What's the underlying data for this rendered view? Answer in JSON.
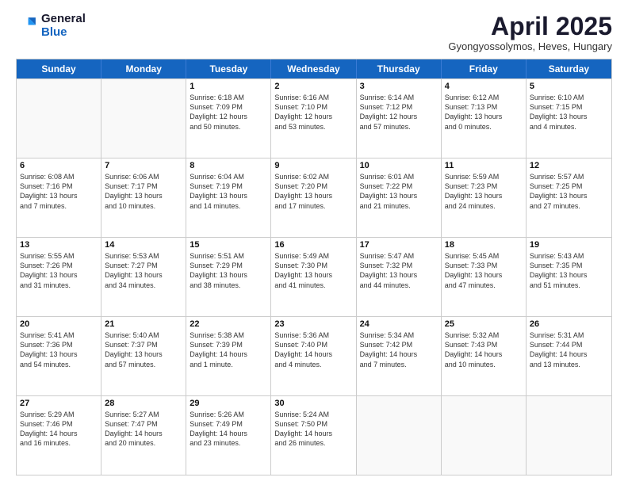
{
  "logo": {
    "general": "General",
    "blue": "Blue"
  },
  "title": "April 2025",
  "subtitle": "Gyongyossolymos, Heves, Hungary",
  "header_days": [
    "Sunday",
    "Monday",
    "Tuesday",
    "Wednesday",
    "Thursday",
    "Friday",
    "Saturday"
  ],
  "weeks": [
    [
      {
        "day": "",
        "info": ""
      },
      {
        "day": "",
        "info": ""
      },
      {
        "day": "1",
        "info": "Sunrise: 6:18 AM\nSunset: 7:09 PM\nDaylight: 12 hours\nand 50 minutes."
      },
      {
        "day": "2",
        "info": "Sunrise: 6:16 AM\nSunset: 7:10 PM\nDaylight: 12 hours\nand 53 minutes."
      },
      {
        "day": "3",
        "info": "Sunrise: 6:14 AM\nSunset: 7:12 PM\nDaylight: 12 hours\nand 57 minutes."
      },
      {
        "day": "4",
        "info": "Sunrise: 6:12 AM\nSunset: 7:13 PM\nDaylight: 13 hours\nand 0 minutes."
      },
      {
        "day": "5",
        "info": "Sunrise: 6:10 AM\nSunset: 7:15 PM\nDaylight: 13 hours\nand 4 minutes."
      }
    ],
    [
      {
        "day": "6",
        "info": "Sunrise: 6:08 AM\nSunset: 7:16 PM\nDaylight: 13 hours\nand 7 minutes."
      },
      {
        "day": "7",
        "info": "Sunrise: 6:06 AM\nSunset: 7:17 PM\nDaylight: 13 hours\nand 10 minutes."
      },
      {
        "day": "8",
        "info": "Sunrise: 6:04 AM\nSunset: 7:19 PM\nDaylight: 13 hours\nand 14 minutes."
      },
      {
        "day": "9",
        "info": "Sunrise: 6:02 AM\nSunset: 7:20 PM\nDaylight: 13 hours\nand 17 minutes."
      },
      {
        "day": "10",
        "info": "Sunrise: 6:01 AM\nSunset: 7:22 PM\nDaylight: 13 hours\nand 21 minutes."
      },
      {
        "day": "11",
        "info": "Sunrise: 5:59 AM\nSunset: 7:23 PM\nDaylight: 13 hours\nand 24 minutes."
      },
      {
        "day": "12",
        "info": "Sunrise: 5:57 AM\nSunset: 7:25 PM\nDaylight: 13 hours\nand 27 minutes."
      }
    ],
    [
      {
        "day": "13",
        "info": "Sunrise: 5:55 AM\nSunset: 7:26 PM\nDaylight: 13 hours\nand 31 minutes."
      },
      {
        "day": "14",
        "info": "Sunrise: 5:53 AM\nSunset: 7:27 PM\nDaylight: 13 hours\nand 34 minutes."
      },
      {
        "day": "15",
        "info": "Sunrise: 5:51 AM\nSunset: 7:29 PM\nDaylight: 13 hours\nand 38 minutes."
      },
      {
        "day": "16",
        "info": "Sunrise: 5:49 AM\nSunset: 7:30 PM\nDaylight: 13 hours\nand 41 minutes."
      },
      {
        "day": "17",
        "info": "Sunrise: 5:47 AM\nSunset: 7:32 PM\nDaylight: 13 hours\nand 44 minutes."
      },
      {
        "day": "18",
        "info": "Sunrise: 5:45 AM\nSunset: 7:33 PM\nDaylight: 13 hours\nand 47 minutes."
      },
      {
        "day": "19",
        "info": "Sunrise: 5:43 AM\nSunset: 7:35 PM\nDaylight: 13 hours\nand 51 minutes."
      }
    ],
    [
      {
        "day": "20",
        "info": "Sunrise: 5:41 AM\nSunset: 7:36 PM\nDaylight: 13 hours\nand 54 minutes."
      },
      {
        "day": "21",
        "info": "Sunrise: 5:40 AM\nSunset: 7:37 PM\nDaylight: 13 hours\nand 57 minutes."
      },
      {
        "day": "22",
        "info": "Sunrise: 5:38 AM\nSunset: 7:39 PM\nDaylight: 14 hours\nand 1 minute."
      },
      {
        "day": "23",
        "info": "Sunrise: 5:36 AM\nSunset: 7:40 PM\nDaylight: 14 hours\nand 4 minutes."
      },
      {
        "day": "24",
        "info": "Sunrise: 5:34 AM\nSunset: 7:42 PM\nDaylight: 14 hours\nand 7 minutes."
      },
      {
        "day": "25",
        "info": "Sunrise: 5:32 AM\nSunset: 7:43 PM\nDaylight: 14 hours\nand 10 minutes."
      },
      {
        "day": "26",
        "info": "Sunrise: 5:31 AM\nSunset: 7:44 PM\nDaylight: 14 hours\nand 13 minutes."
      }
    ],
    [
      {
        "day": "27",
        "info": "Sunrise: 5:29 AM\nSunset: 7:46 PM\nDaylight: 14 hours\nand 16 minutes."
      },
      {
        "day": "28",
        "info": "Sunrise: 5:27 AM\nSunset: 7:47 PM\nDaylight: 14 hours\nand 20 minutes."
      },
      {
        "day": "29",
        "info": "Sunrise: 5:26 AM\nSunset: 7:49 PM\nDaylight: 14 hours\nand 23 minutes."
      },
      {
        "day": "30",
        "info": "Sunrise: 5:24 AM\nSunset: 7:50 PM\nDaylight: 14 hours\nand 26 minutes."
      },
      {
        "day": "",
        "info": ""
      },
      {
        "day": "",
        "info": ""
      },
      {
        "day": "",
        "info": ""
      }
    ]
  ]
}
